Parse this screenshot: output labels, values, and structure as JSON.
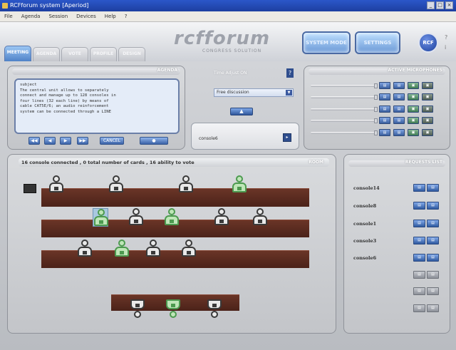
{
  "window": {
    "title": "RCFforum system [Aperiod]"
  },
  "menu": [
    "File",
    "Agenda",
    "Session",
    "Devices",
    "Help",
    "?"
  ],
  "header": {
    "logo_main": "rcfforum",
    "logo_sub": "CONGRESS SOLUTION",
    "btn_left": "SYSTEM MODE",
    "btn_right": "SETTINGS",
    "badge": "RCF"
  },
  "tabs": [
    "MEETING",
    "AGENDA",
    "VOTE",
    "PROFILE",
    "DESIGN"
  ],
  "agenda": {
    "title": "AGENDA",
    "text": "subject\nThe central unit allows to separately\nconnect and manage up to 128 consoles in\nfour lines (32 each line) by means of\ncable CAT5E/6; an audio reinforcement\nsystem can be connected through a LINE",
    "controls": [
      "◀◀",
      "◀",
      "▶",
      "▶▶",
      "CANCEL",
      "●"
    ]
  },
  "middle": {
    "label": "Time Adjust ON",
    "help": "?",
    "select_value": "Free discussion",
    "input_value": "console6"
  },
  "mics": {
    "title": "ACTIVE MICROPHONES",
    "rows": 5
  },
  "room": {
    "title": "ROOM",
    "status": "16 console connected , 0 total number of cards , 16 ability to vote"
  },
  "list": {
    "title": "REQUESTS LIST",
    "consoles": [
      "console14",
      "console8",
      "console1",
      "console3",
      "console6",
      "",
      "",
      ""
    ]
  },
  "colors": {
    "accent": "#4f82c8",
    "desk": "#5a2b20",
    "active_green": "#4c9a4f"
  }
}
